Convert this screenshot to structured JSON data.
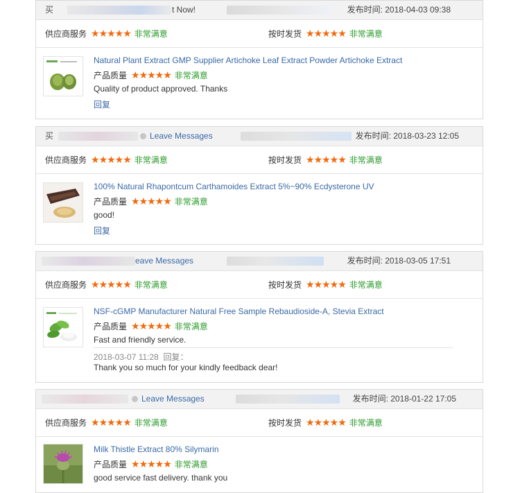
{
  "labels": {
    "buyer_prefix": "买",
    "supplier_service": "供应商服务",
    "on_time_delivery": "按时发货",
    "product_quality": "产品质量",
    "very_satisfied": "非常满意",
    "stars": "★★★★★",
    "post_time_prefix": "发布时间: ",
    "reply_link": "回复",
    "reply_label": "回复："
  },
  "colors": {
    "star": "#f06a0f",
    "satisfied": "#2c9a2c",
    "link": "#3a68a6"
  },
  "reviews": [
    {
      "header_text": "t Now!",
      "post_time": "2018-04-03 09:38",
      "product_title": "Natural Plant Extract GMP Supplier Artichoke Leaf Extract Powder Artichoke Extract",
      "thumb_icon": "artichoke-image",
      "comment": "Quality of product approved. Thanks"
    },
    {
      "header_text": "Leave Messages",
      "post_time": "2018-03-23 12:05",
      "product_title": "100% Natural Rhapontcum Carthamoides Extract 5%~90% Ecdysterone UV",
      "thumb_icon": "rhaponticum-root-image",
      "comment": "good!"
    },
    {
      "header_text": "eave Messages",
      "post_time": "2018-03-05 17:51",
      "product_title": "NSF-cGMP Manufacturer Natural Free Sample Rebaudioside-A, Stevia Extract",
      "thumb_icon": "stevia-image",
      "comment": "Fast and friendly service.",
      "reply_time": "2018-03-07 11:28",
      "reply_text": "Thank you so much for your kindly feedback dear!"
    },
    {
      "header_text": "Leave Messages",
      "post_time": "2018-01-22 17:05",
      "product_title": "Milk Thistle Extract 80% Silymarin",
      "thumb_icon": "milk-thistle-image",
      "comment": "good service fast delivery. thank you"
    }
  ]
}
